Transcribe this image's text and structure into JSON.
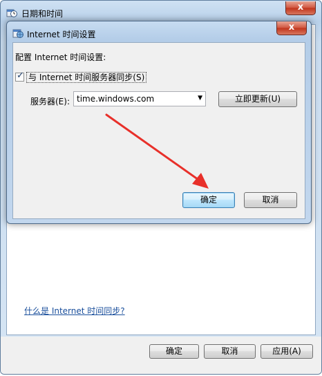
{
  "outer_window": {
    "title": "日期和时间",
    "close_glyph": "x",
    "help_link": "什么是 Internet 时间同步?",
    "buttons": {
      "ok": "确定",
      "cancel": "取消",
      "apply": "应用(A)"
    }
  },
  "dialog": {
    "title": "Internet 时间设置",
    "close_glyph": "x",
    "config_label": "配置 Internet 时间设置:",
    "sync_checkbox": {
      "label": "与 Internet 时间服务器同步(S)",
      "checked": true,
      "tick": "✓"
    },
    "server": {
      "label": "服务器(E):",
      "value": "time.windows.com",
      "dropdown_glyph": "▼",
      "update_button": "立即更新(U)"
    },
    "buttons": {
      "ok": "确定",
      "cancel": "取消"
    }
  },
  "colors": {
    "annotation_arrow": "#e8302a",
    "titlebar": "#b9d1ea",
    "link": "#1a4f9c"
  }
}
